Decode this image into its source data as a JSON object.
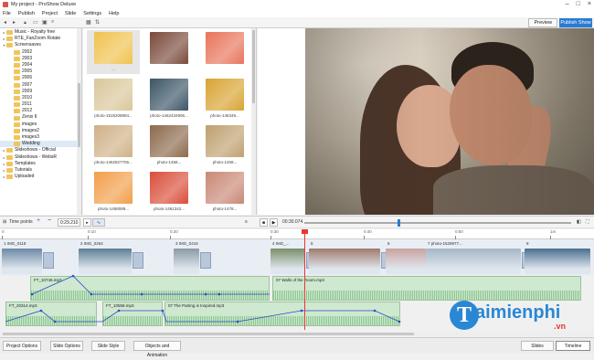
{
  "window": {
    "title": "My project - ProShow Deluxe"
  },
  "menu": [
    "File",
    "Publish",
    "Project",
    "Slide",
    "Settings",
    "Help"
  ],
  "toolbar": {
    "preview_label": "Preview",
    "publish_label": "Publish Show"
  },
  "folders": [
    {
      "label": "Music - Royalty free",
      "level": 0,
      "arrow": "▸"
    },
    {
      "label": "RTE_FanZoom Rotate",
      "level": 0,
      "arrow": "▸"
    },
    {
      "label": "Screensaves",
      "level": 0,
      "arrow": "▾"
    },
    {
      "label": "2002",
      "level": 1,
      "arrow": ""
    },
    {
      "label": "2003",
      "level": 1,
      "arrow": ""
    },
    {
      "label": "2004",
      "level": 1,
      "arrow": ""
    },
    {
      "label": "2005",
      "level": 1,
      "arrow": ""
    },
    {
      "label": "2006",
      "level": 1,
      "arrow": ""
    },
    {
      "label": "2007",
      "level": 1,
      "arrow": ""
    },
    {
      "label": "2009",
      "level": 1,
      "arrow": ""
    },
    {
      "label": "2010",
      "level": 1,
      "arrow": ""
    },
    {
      "label": "2011",
      "level": 1,
      "arrow": ""
    },
    {
      "label": "2012",
      "level": 1,
      "arrow": ""
    },
    {
      "label": "Zenix II",
      "level": 1,
      "arrow": ""
    },
    {
      "label": "images",
      "level": 1,
      "arrow": ""
    },
    {
      "label": "images2",
      "level": 1,
      "arrow": ""
    },
    {
      "label": "images3",
      "level": 1,
      "arrow": ""
    },
    {
      "label": "Wedding",
      "level": 1,
      "arrow": ""
    },
    {
      "label": "Slideshows - Official",
      "level": 0,
      "arrow": "▸"
    },
    {
      "label": "Slideshows - WebsR",
      "level": 0,
      "arrow": "▸"
    },
    {
      "label": "Templates",
      "level": 0,
      "arrow": "▸"
    },
    {
      "label": "Tutorials",
      "level": 0,
      "arrow": "▸"
    },
    {
      "label": "Uploaded",
      "level": 0,
      "arrow": "▸"
    }
  ],
  "thumbnails": [
    {
      "caption": "...",
      "color": "#f0c24e"
    },
    {
      "caption": "",
      "color": "#7a4a3a"
    },
    {
      "caption": "",
      "color": "#e8745a"
    },
    {
      "caption": "photo-1515208894...",
      "color": "#d9c79a"
    },
    {
      "caption": "photo-1462434906...",
      "color": "#3c5566"
    },
    {
      "caption": "photo-146349...",
      "color": "#d9a332"
    },
    {
      "caption": "photo-1462827706...",
      "color": "#cfb187"
    },
    {
      "caption": "photo-1468...",
      "color": "#8c6a4c"
    },
    {
      "caption": "photo-1468...",
      "color": "#bfa070"
    },
    {
      "caption": "photo-1468089...",
      "color": "#f29e4a"
    },
    {
      "caption": "photo-1461342...",
      "color": "#d94e3a"
    },
    {
      "caption": "photo-1478...",
      "color": "#c98876"
    }
  ],
  "playbar": {
    "time_points_label": "Time points",
    "position": "0:29.210",
    "current_time": "00:30.074"
  },
  "ruler": [
    "0",
    "0:10",
    "0:20",
    "0:30",
    "0:40",
    "0:50",
    "1m"
  ],
  "slides": [
    {
      "label": "1  IMG_0118",
      "color": "#6c8aa8"
    },
    {
      "label": "2  IMG_0264",
      "color": "#5e7f96"
    },
    {
      "label": "3  IMG_0416",
      "color": "#8a9aa4"
    },
    {
      "label": "4  IMG_...",
      "color": "#7a8f6a"
    },
    {
      "label": "5",
      "color": "#a07a6c"
    },
    {
      "label": "6",
      "color": "#c9a2a0"
    },
    {
      "label": "7  photo-1529977...",
      "color": "#a5b7c7"
    },
    {
      "label": "8",
      "color": "#4c6f8f"
    }
  ],
  "audio": [
    {
      "label": "FT_10746.mp3"
    },
    {
      "label": "07 Walls of the Room.mp3"
    },
    {
      "label": "FT_20314.mp3"
    },
    {
      "label": "FT_10558.mp3"
    },
    {
      "label": "07 The Parting is Inspired.mp3"
    }
  ],
  "bottom": {
    "project_options": "Project Options",
    "slide_options": "Slide Options",
    "slide_style": "Slide Style",
    "objects_animation": "Objects and Animation",
    "slides_tab": "Slides",
    "timeline_tab": "Timeline"
  },
  "watermark": {
    "letter": "T",
    "name": "aimienphi",
    "suffix": ".vn"
  }
}
